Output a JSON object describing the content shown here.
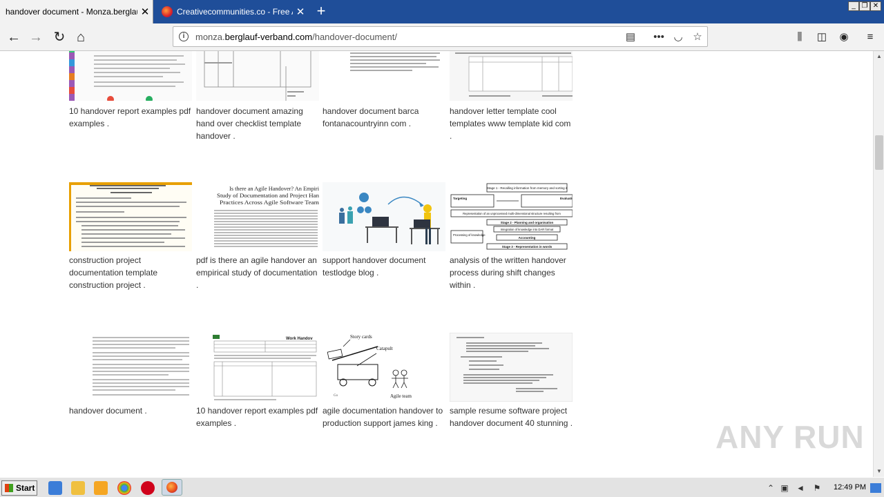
{
  "browser": {
    "tabs": [
      {
        "title": "handover document - Monza.berglauf-",
        "active": true
      },
      {
        "title": "Creativecommunities.co - Free All",
        "active": false
      }
    ],
    "new_tab_symbol": "+",
    "url_prefix": "monza.",
    "url_domain": "berglauf-verband.com",
    "url_path": "/handover-document/"
  },
  "cards": [
    {
      "caption": "10 handover report examples pdf examples ."
    },
    {
      "caption": "handover document amazing hand over checklist template handover ."
    },
    {
      "caption": "handover document barca fontanacountryinn com ."
    },
    {
      "caption": "handover letter template cool templates www template kid com ."
    },
    {
      "caption": "construction project documentation template construction project ."
    },
    {
      "caption": "pdf is there an agile handover an empirical study of documentation ."
    },
    {
      "caption": "support handover document testlodge blog ."
    },
    {
      "caption": "analysis of the written handover process during shift changes within ."
    },
    {
      "caption": "handover document ."
    },
    {
      "caption": "10 handover report examples pdf examples ."
    },
    {
      "caption": "agile documentation handover to production support james king ."
    },
    {
      "caption": "sample resume software project handover document 40 stunning ."
    }
  ],
  "thumb_text": {
    "agile_title": "Is there an Agile Handover? An Empiri Study of Documentation and Project Han Practices Across Agile Software Team",
    "flow_stage1": "Stage 1 - Recalling information from memory and sorting it",
    "flow_targeting": "Targeting",
    "flow_evaluation": "Evaluation",
    "flow_representation": "Representation of an unprocessed multi-dimensional structure resulting from",
    "flow_stage2": "Stage 2 - Planning and organisation",
    "flow_integration": "Integration of knowledge into DAR format",
    "flow_processing": "Processing of knowledge",
    "flow_accounting": "Accounting",
    "flow_stage3": "Stage 3 - Representation in words",
    "story_cards": "Story cards",
    "catapult": "Catapult",
    "agile_team": "Agile team",
    "work_handover": "Work Handov"
  },
  "watermark": "ANY RUN",
  "taskbar": {
    "start_label": "Start",
    "clock": "12:49 PM"
  }
}
